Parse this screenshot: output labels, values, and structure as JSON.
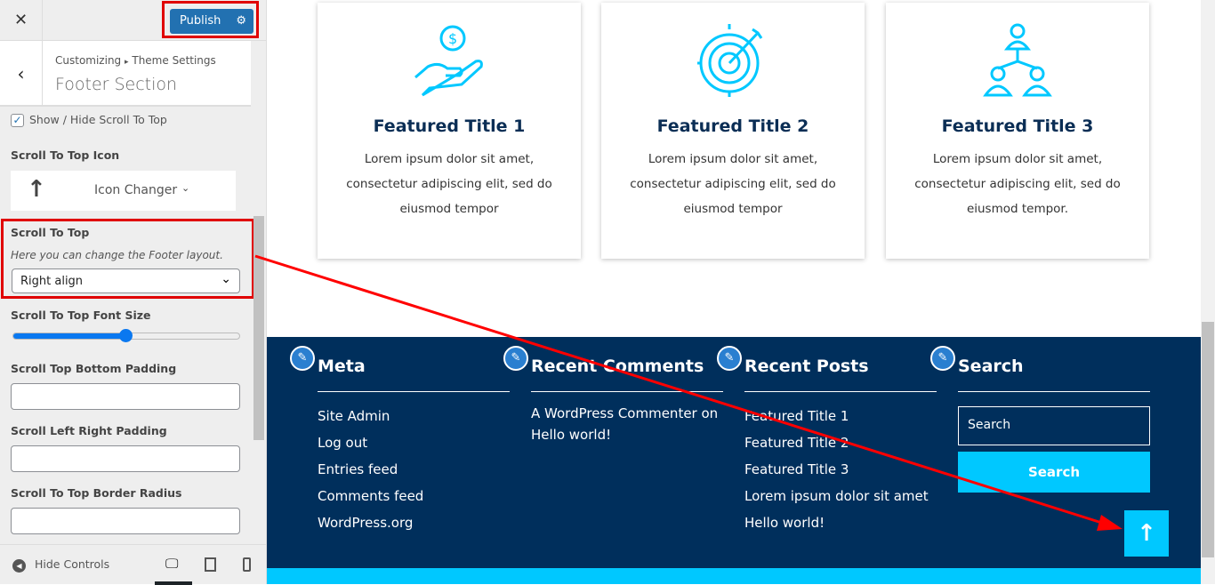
{
  "sidebar": {
    "close": "✕",
    "publish": "Publish",
    "breadcrumb_root": "Customizing",
    "breadcrumb_sep": "▸",
    "breadcrumb_parent": "Theme Settings",
    "title": "Footer Section",
    "show_hide_label": "Show / Hide Scroll To Top",
    "show_hide_checked": true,
    "icon_label": "Scroll To Top Icon",
    "icon_changer": "Icon Changer",
    "scroll_label": "Scroll To Top",
    "scroll_desc": "Here you can change the Footer layout.",
    "scroll_value": "Right align",
    "font_size_label": "Scroll To Top Font Size",
    "font_size_percent": 50,
    "bottom_padding_label": "Scroll Top Bottom Padding",
    "lr_padding_label": "Scroll Left Right Padding",
    "radius_label": "Scroll To Top Border Radius",
    "hide_controls": "Hide Controls"
  },
  "cards": [
    {
      "title": "Featured Title 1",
      "text": "Lorem ipsum dolor sit amet, consectetur adipiscing elit, sed do eiusmod tempor",
      "icon": "money-hand-icon"
    },
    {
      "title": "Featured Title 2",
      "text": "Lorem ipsum dolor sit amet, consectetur adipiscing elit, sed do eiusmod tempor",
      "icon": "target-icon"
    },
    {
      "title": "Featured Title 3",
      "text": "Lorem ipsum dolor sit amet, consectetur adipiscing elit, sed do eiusmod tempor.",
      "icon": "team-icon"
    }
  ],
  "footer": {
    "meta": {
      "title": "Meta",
      "links": [
        "Site Admin",
        "Log out",
        "Entries feed",
        "Comments feed",
        "WordPress.org"
      ]
    },
    "comments": {
      "title": "Recent Comments",
      "links": [
        "A WordPress Commenter on Hello world!"
      ]
    },
    "posts": {
      "title": "Recent Posts",
      "links": [
        "Featured Title 1",
        "Featured Title 2",
        "Featured Title 3",
        "Lorem ipsum dolor sit amet",
        "Hello world!"
      ]
    },
    "search": {
      "title": "Search",
      "placeholder": "Search",
      "button": "Search"
    }
  },
  "colors": {
    "accent": "#00c8ff",
    "footer_bg": "#002f5c",
    "publish": "#2271b1",
    "highlight": "#e00000"
  }
}
